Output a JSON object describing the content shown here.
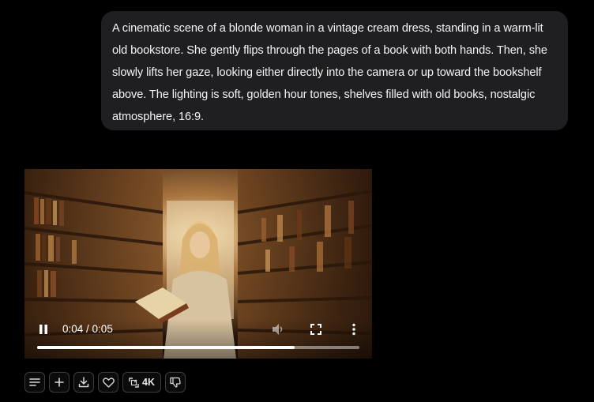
{
  "prompt": {
    "text": "A cinematic scene of a blonde woman in a vintage cream dress, standing in a warm-lit old bookstore. She gently flips through the pages of a book with both hands. Then, she slowly lifts her gaze, looking either directly into the camera or up toward the bookshelf above. The lighting is soft, golden hour tones, shelves filled with old books, nostalgic atmosphere, 16:9."
  },
  "video": {
    "current_time": "0:04",
    "separator": " / ",
    "duration": "0:05",
    "progress_fraction": 0.8,
    "play_icon": "pause-icon",
    "volume_icon": "volume-icon",
    "fullscreen_icon": "fullscreen-icon",
    "more_icon": "more-vertical-icon"
  },
  "toolbar": {
    "items": [
      {
        "name": "details-button",
        "icon": "lines-icon"
      },
      {
        "name": "add-button",
        "icon": "plus-icon"
      },
      {
        "name": "download-button",
        "icon": "download-icon"
      },
      {
        "name": "like-button",
        "icon": "heart-icon"
      },
      {
        "name": "upscale-button",
        "icon": "upscale-icon",
        "label": "4K"
      },
      {
        "name": "dislike-button",
        "icon": "thumbs-down-icon"
      }
    ]
  },
  "colors": {
    "background": "#000000",
    "bubble": "#1f1f21",
    "button_border": "#3c3c40"
  }
}
